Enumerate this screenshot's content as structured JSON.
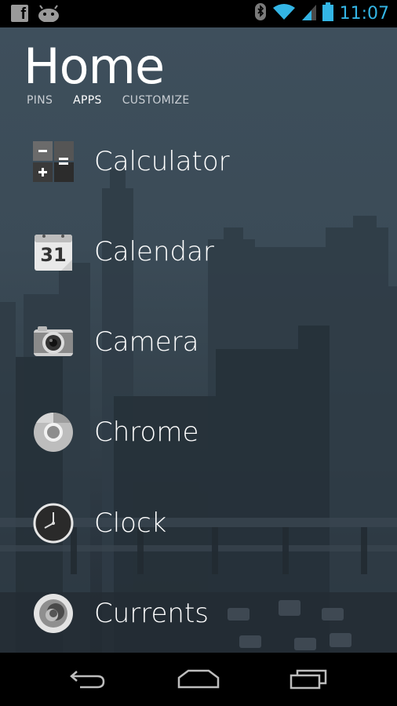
{
  "status_bar": {
    "time": "11:07",
    "left_icons": [
      "facebook-icon",
      "android-debug-icon"
    ],
    "right_icons": [
      "bluetooth-icon",
      "wifi-icon",
      "signal-icon",
      "battery-icon"
    ],
    "facebook_glyph": "f",
    "accent_color": "#33b5e5"
  },
  "header": {
    "title": "Home",
    "tabs": [
      {
        "label": "PINS",
        "active": false
      },
      {
        "label": "APPS",
        "active": true
      },
      {
        "label": "CUSTOMIZE",
        "active": false
      }
    ]
  },
  "apps": [
    {
      "label": "Calculator",
      "icon": "calculator-icon"
    },
    {
      "label": "Calendar",
      "icon": "calendar-icon",
      "icon_text": "31"
    },
    {
      "label": "Camera",
      "icon": "camera-icon"
    },
    {
      "label": "Chrome",
      "icon": "chrome-icon"
    },
    {
      "label": "Clock",
      "icon": "clock-icon"
    },
    {
      "label": "Currents",
      "icon": "currents-icon"
    }
  ],
  "nav_bar": {
    "buttons": [
      "back-icon",
      "home-icon",
      "recents-icon"
    ]
  }
}
